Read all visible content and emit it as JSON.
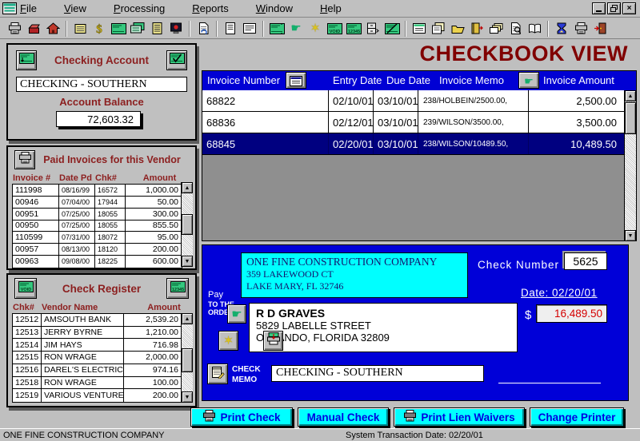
{
  "colors": {
    "accent_maroon": "#800000",
    "panel_label_maroon": "#8C1F1F",
    "header_blue": "#0000D4",
    "check_area_blue": "#0000D8",
    "selected_row_navy": "#000080",
    "cyan": "#00FFFF",
    "amount_red": "#D40000"
  },
  "window": {
    "menu_items": [
      "File",
      "View",
      "Processing",
      "Reports",
      "Window",
      "Help"
    ],
    "controls": {
      "minimize": "minimize",
      "restore": "restore",
      "close": "close"
    }
  },
  "toolbar": {
    "groups": [
      [
        "print",
        "vendor-cards",
        "home"
      ],
      [
        "ledger",
        "dollar",
        "check",
        "copy-check",
        "list-doc",
        "monitor"
      ],
      [
        "refresh-doc"
      ],
      [
        "doc-portrait",
        "doc-landscape"
      ],
      [
        "transfer-check",
        "pointer-flag",
        "wand",
        "void-check",
        "numbered-check",
        "archive",
        "edit-check"
      ],
      [
        "form",
        "copy-form",
        "open-folder",
        "exit-book",
        "copies",
        "search-doc",
        "book"
      ],
      [
        "hourglass",
        "print-setup",
        "exit-door"
      ]
    ]
  },
  "page_title": "CHECKBOOK VIEW",
  "checking_account": {
    "label": "Checking Account",
    "value": "CHECKING - SOUTHERN",
    "balance_label": "Account Balance",
    "balance": "72,603.32"
  },
  "paid_invoices": {
    "title": "Paid Invoices for this Vendor",
    "columns": [
      "Invoice #",
      "Date Pd",
      "Chk#",
      "Amount"
    ],
    "rows": [
      [
        "111998",
        "08/16/99",
        "16572",
        "1,000.00"
      ],
      [
        "00946",
        "07/04/00",
        "17944",
        "50.00"
      ],
      [
        "00951",
        "07/25/00",
        "18055",
        "300.00"
      ],
      [
        "00950",
        "07/25/00",
        "18055",
        "855.50"
      ],
      [
        "110599",
        "07/31/00",
        "18072",
        "95.00"
      ],
      [
        "00957",
        "08/13/00",
        "18120",
        "200.00"
      ],
      [
        "00963",
        "09/08/00",
        "18225",
        "600.00"
      ]
    ]
  },
  "check_register": {
    "title": "Check Register",
    "columns": [
      "Chk#",
      "Vendor Name",
      "Amount"
    ],
    "rows": [
      [
        "12512",
        "AMSOUTH BANK",
        "2,539.20"
      ],
      [
        "12513",
        "JERRY BYRNE",
        "1,210.00"
      ],
      [
        "12514",
        "JIM HAYS",
        "716.98"
      ],
      [
        "12515",
        "RON WRAGE",
        "2,000.00"
      ],
      [
        "12516",
        "DAREL'S ELECTRICA",
        "974.16"
      ],
      [
        "12518",
        "RON WRAGE",
        "100.00"
      ],
      [
        "12519",
        "VARIOUS VENTURE",
        "200.00"
      ]
    ]
  },
  "invoice_table": {
    "headers": {
      "number": "Invoice Number",
      "entry": "Entry Date",
      "due": "Due Date",
      "memo": "Invoice Memo",
      "amount": "Invoice Amount"
    },
    "rows": [
      {
        "number": "68822",
        "entry": "02/10/01",
        "due": "03/10/01",
        "memo": "238/HOLBEIN/2500.00,",
        "amount": "2,500.00",
        "selected": false
      },
      {
        "number": "68836",
        "entry": "02/12/01",
        "due": "03/10/01",
        "memo": "239/WILSON/3500.00,",
        "amount": "3,500.00",
        "selected": false
      },
      {
        "number": "68845",
        "entry": "02/20/01",
        "due": "03/10/01",
        "memo": "238/WILSON/10489.50,",
        "amount": "10,489.50",
        "selected": true
      }
    ]
  },
  "check": {
    "company_line1": "ONE FINE CONSTRUCTION COMPANY",
    "company_line2": "359 LAKEWOOD CT",
    "company_line3": "LAKE MARY, FL  32746",
    "check_number_label": "Check Number",
    "check_number": "5625",
    "date_text": "Date:   02/20/01",
    "pay_line1": "Pay",
    "pay_line2": "TO THE",
    "pay_line3": "ORDER OF",
    "payee_name": "R D GRAVES",
    "payee_addr1": "5829 LABELLE STREET",
    "payee_addr2": "ORLANDO, FLORIDA 32809",
    "dollar": "$",
    "amount": "16,489.50",
    "memo_label_line1": "CHECK",
    "memo_label_line2": "MEMO",
    "memo_value": "CHECKING - SOUTHERN"
  },
  "action_buttons": {
    "print_check": "Print Check",
    "manual_check": "Manual Check",
    "print_lien_waivers": "Print Lien Waivers",
    "change_printer": "Change Printer"
  },
  "status": {
    "left": "ONE FINE CONSTRUCTION COMPANY",
    "center": "System Transaction Date:  02/20/01"
  }
}
